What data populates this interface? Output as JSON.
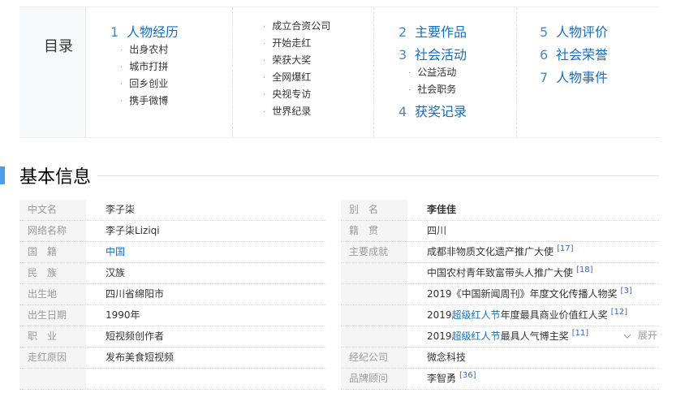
{
  "toc": {
    "title": "目录",
    "col1": {
      "heading_num": "1",
      "heading": "人物经历",
      "items": [
        "出身农村",
        "城市打拼",
        "回乡创业",
        "携手微博"
      ]
    },
    "col2": {
      "items": [
        "成立合资公司",
        "开始走红",
        "荣获大奖",
        "全网爆红",
        "央视专访",
        "世界纪录"
      ]
    },
    "col3": {
      "h2_num": "2",
      "h2": "主要作品",
      "h3_num": "3",
      "h3": "社会活动",
      "h3_items": [
        "公益活动",
        "社会职务"
      ],
      "h4_num": "4",
      "h4": "获奖记录"
    },
    "col4": {
      "h5_num": "5",
      "h5": "人物评价",
      "h6_num": "6",
      "h6": "社会荣誉",
      "h7_num": "7",
      "h7": "人物事件"
    }
  },
  "basic_info": {
    "title": "基本信息",
    "left": [
      {
        "label": "中文名",
        "value": "李子柒"
      },
      {
        "label": "网络名称",
        "value": "李子柒Liziqi"
      },
      {
        "label": "国籍",
        "value": "中国"
      },
      {
        "label": "民族",
        "value": "汉族"
      },
      {
        "label": "出生地",
        "value": "四川省绵阳市"
      },
      {
        "label": "出生日期",
        "value": "1990年"
      },
      {
        "label": "职业",
        "value": "短视频创作者"
      },
      {
        "label": "走红原因",
        "value": "发布美食短视频"
      }
    ],
    "right": [
      {
        "label": "别名",
        "value": "李佳佳"
      },
      {
        "label": "籍贯",
        "value": "四川"
      },
      {
        "label": "主要成就",
        "value": "成都非物质文化遗产推广大使",
        "ref": "[17]"
      },
      {
        "label": "",
        "value": "中国农村青年致富带头人推广大使",
        "ref": "[18]"
      },
      {
        "label": "",
        "value": "2019《中国新闻周刊》年度文化传播人物奖",
        "ref": "[3]"
      },
      {
        "label": "",
        "value_prefix": "2019",
        "value_link": "超级红人节",
        "value_suffix": "年度最具商业价值红人奖",
        "ref": "[12]"
      },
      {
        "label": "",
        "value_prefix": "2019",
        "value_link": "超级红人节",
        "value_suffix": "最具人气博主奖",
        "ref": "[11]"
      },
      {
        "label": "经纪公司",
        "value": "微念科技"
      },
      {
        "label": "品牌顾问",
        "value": "李智勇",
        "ref": "[36]"
      }
    ],
    "expand_label": "展开"
  }
}
